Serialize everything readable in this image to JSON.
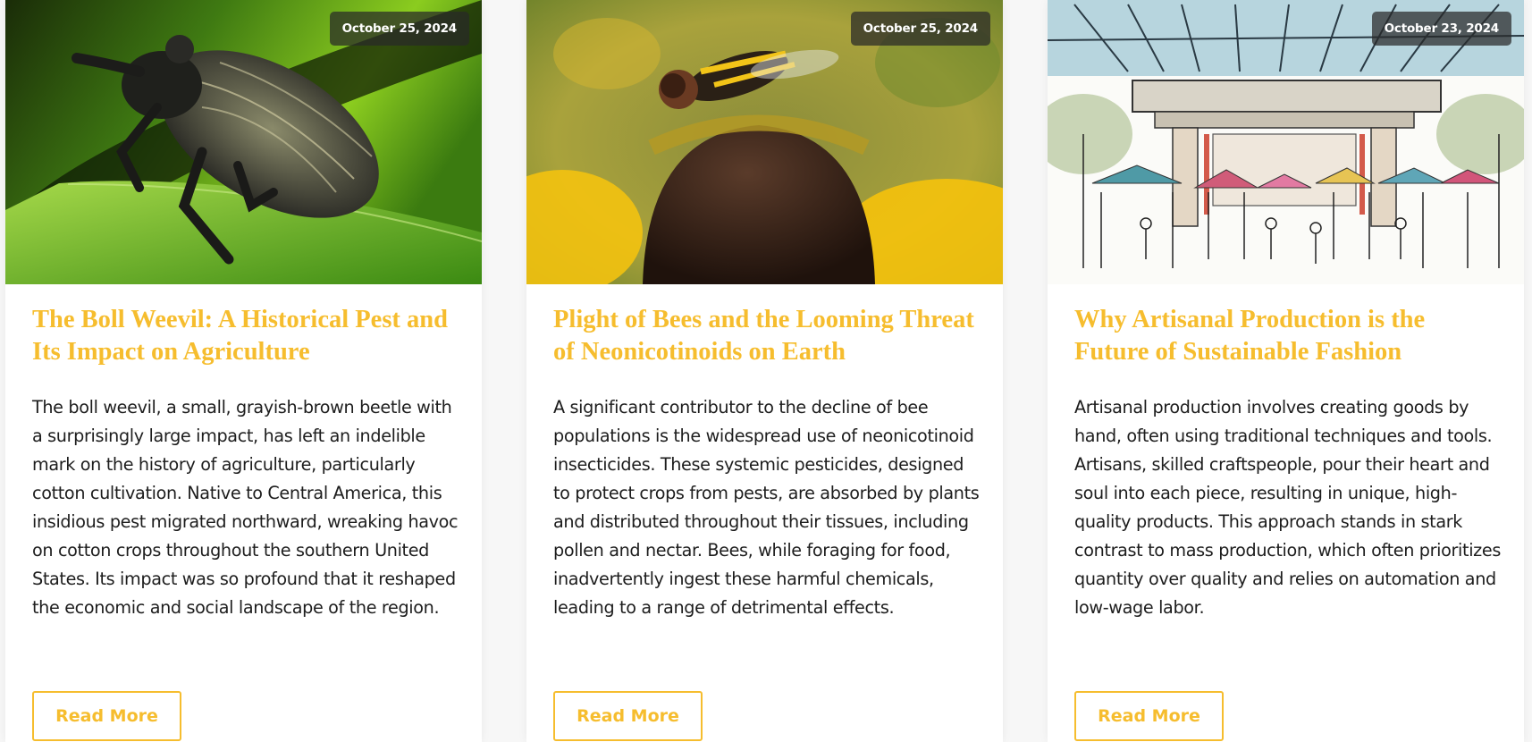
{
  "posts": [
    {
      "date": "October 25, 2024",
      "image": "weevil-on-leaf-photo",
      "title": "The Boll Weevil: A Historical Pest and Its Impact on Agriculture",
      "excerpt": "The boll weevil, a small, grayish-brown beetle with a surprisingly large impact, has left an indelible mark on the history of agriculture, particularly cotton cultivation. Native to Central America, this insidious pest migrated northward, wreaking havoc on cotton crops throughout the southern United States. Its impact was so profound that it reshaped the economic and social landscape of the region.",
      "read_more": "Read More"
    },
    {
      "date": "October 25, 2024",
      "image": "bee-on-flower-photo",
      "title": "Plight of Bees and the Looming Threat of Neonicotinoids on Earth",
      "excerpt": "A significant contributor to the decline of bee populations is the widespread use of neonicotinoid insecticides. These systemic pesticides, designed to protect crops from pests, are absorbed by plants and distributed throughout their tissues, including pollen and nectar. Bees, while foraging for food, inadvertently ingest these harmful chemicals, leading to a range of detrimental effects.",
      "read_more": "Read More"
    },
    {
      "date": "October 23, 2024",
      "image": "market-sketch-illustration",
      "title": "Why Artisanal Production is the Future of Sustainable Fashion",
      "excerpt": "Artisanal production involves creating goods by hand, often using traditional techniques and tools. Artisans, skilled craftspeople, pour their heart and soul into each piece, resulting in unique, high-quality products. This approach stands in stark contrast to mass production, which often prioritizes quantity over quality and relies on automation and low-wage labor.",
      "read_more": "Read More"
    }
  ],
  "colors": {
    "accent": "#f6bd2e",
    "text": "#1d1d1d",
    "date_badge_bg": "#3c3c3c",
    "page_bg": "#f7f7f7"
  }
}
